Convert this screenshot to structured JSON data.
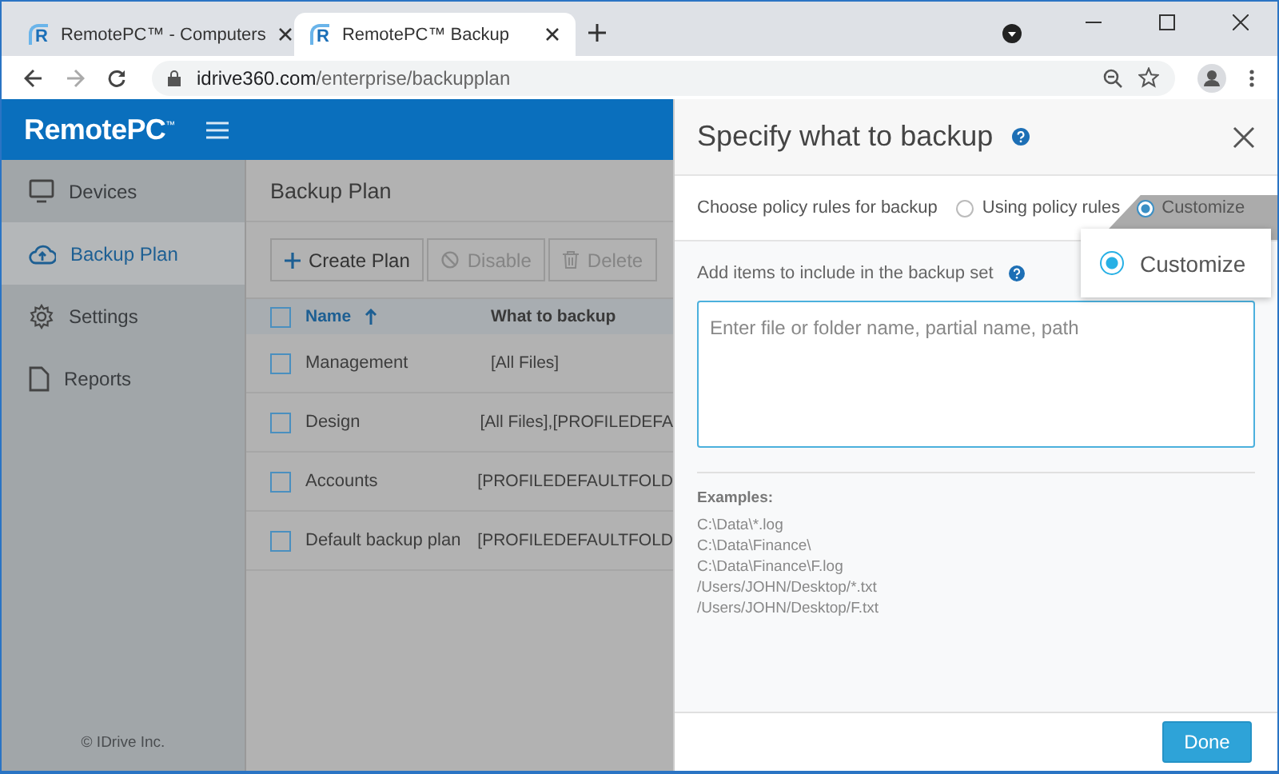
{
  "browser": {
    "tabs": [
      {
        "favicon": "R",
        "title": "RemotePC™ - Computers",
        "selected": false
      },
      {
        "favicon": "R",
        "title": "RemotePC™ Backup",
        "selected": true
      }
    ],
    "address": {
      "domain": "idrive360.com",
      "path": "/enterprise/backupplan"
    }
  },
  "app": {
    "logo": "RemotePC$^{™}$"
  },
  "sidebar": {
    "items": [
      {
        "label": "Devices",
        "kind": "monitor",
        "selected": false
      },
      {
        "label": "Backup Plan",
        "kind": "cloud",
        "selected": true
      },
      {
        "label": "Settings",
        "kind": "gear",
        "selected": false
      },
      {
        "label": "Reports",
        "kind": "document",
        "selected": false
      }
    ],
    "footer": "© IDrive Inc."
  },
  "main": {
    "title": "Backup Plan",
    "toolbar": [
      {
        "label": "Create Plan",
        "kind": "add",
        "disabled": false
      },
      {
        "label": "Disable",
        "kind": "block",
        "disabled": true
      },
      {
        "label": "Delete",
        "kind": "trash",
        "disabled": true
      }
    ],
    "table": {
      "all_checked": false,
      "columns": [
        {
          "label": "Name",
          "sorted": true
        },
        {
          "label": "What to backup",
          "sorted": false
        }
      ],
      "rows": [
        {
          "name": "Management",
          "what": "[All Files]",
          "checked": false
        },
        {
          "name": "Design",
          "what": "[All Files],[PROFILEDEFA",
          "checked": false
        },
        {
          "name": "Accounts",
          "what": "[PROFILEDEFAULTFOLD",
          "checked": false
        },
        {
          "name": "Default backup plan",
          "what": "[PROFILEDEFAULTFOLD",
          "checked": false
        }
      ]
    }
  },
  "panel": {
    "title": "Specify what to backup",
    "policy": {
      "label": "Choose policy rules for backup",
      "options": [
        {
          "label": "Using policy rules",
          "selected": false
        },
        {
          "label": "Customize",
          "selected": true
        }
      ]
    },
    "items_label": "Add items to include in the backup set",
    "input": {
      "placeholder": "Enter file or folder name, partial name, path"
    },
    "examples_title": "Examples:",
    "examples": [
      "C:\\Data\\*.log",
      "C:\\Data\\Finance\\",
      "C:\\Data\\Finance\\F.log",
      "/Users/JOHN/Desktop/*.txt",
      "/Users/JOHN/Desktop/F.txt"
    ],
    "done_button": "Done"
  },
  "callout": {
    "label": "Customize",
    "selected": true
  }
}
